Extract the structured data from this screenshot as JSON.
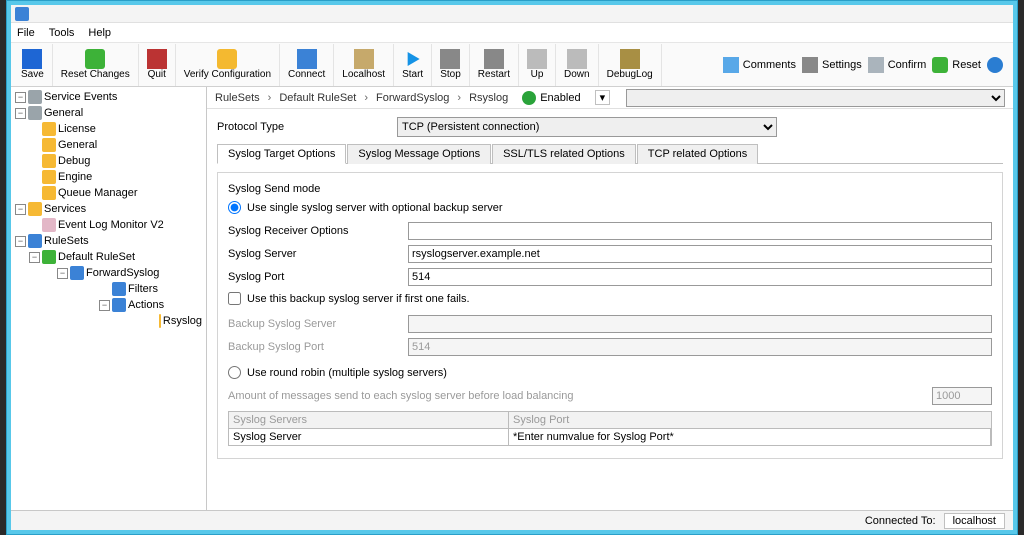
{
  "menu": {
    "file": "File",
    "tools": "Tools",
    "help": "Help"
  },
  "toolbar": {
    "save": "Save",
    "reset_changes": "Reset Changes",
    "quit": "Quit",
    "verify": "Verify Configuration",
    "connect": "Connect",
    "localhost": "Localhost",
    "start": "Start",
    "stop": "Stop",
    "restart": "Restart",
    "up": "Up",
    "down": "Down",
    "debuglog": "DebugLog",
    "comments": "Comments",
    "settings": "Settings",
    "confirm": "Confirm",
    "reset": "Reset"
  },
  "tree": {
    "service_events": "Service Events",
    "general": "General",
    "general_children": {
      "license": "License",
      "general": "General",
      "debug": "Debug",
      "engine": "Engine",
      "queue_manager": "Queue Manager"
    },
    "services": "Services",
    "services_children": {
      "elm": "Event Log Monitor V2"
    },
    "rulesets": "RuleSets",
    "default_ruleset": "Default RuleSet",
    "forwardsyslog": "ForwardSyslog",
    "filters": "Filters",
    "actions": "Actions",
    "rsyslog": "Rsyslog"
  },
  "breadcrumb": {
    "a": "RuleSets",
    "b": "Default RuleSet",
    "c": "ForwardSyslog",
    "d": "Rsyslog",
    "enabled": "Enabled"
  },
  "form": {
    "protocol_type_label": "Protocol Type",
    "protocol_type_value": "TCP (Persistent connection)",
    "tabs": {
      "target": "Syslog Target Options",
      "message": "Syslog Message Options",
      "ssl": "SSL/TLS related Options",
      "tcp": "TCP related Options"
    },
    "send_mode": "Syslog Send mode",
    "radio_single": "Use single syslog server with optional backup server",
    "recv_opts": "Syslog Receiver Options",
    "syslog_server_label": "Syslog Server",
    "syslog_server_value": "rsyslogserver.example.net",
    "syslog_port_label": "Syslog Port",
    "syslog_port_value": "514",
    "chk_backup": "Use this backup syslog server if first one fails.",
    "backup_server_label": "Backup Syslog Server",
    "backup_server_value": "",
    "backup_port_label": "Backup Syslog Port",
    "backup_port_value": "514",
    "radio_rr": "Use round robin (multiple syslog servers)",
    "rr_amount_label": "Amount of messages send to each syslog server before load balancing",
    "rr_amount_value": "1000",
    "grid": {
      "col_servers": "Syslog Servers",
      "col_port": "Syslog Port",
      "row_server": "Syslog Server",
      "row_port_hint": "*Enter numvalue for Syslog Port*"
    }
  },
  "status": {
    "connected_label": "Connected To:",
    "connected_value": "localhost"
  }
}
